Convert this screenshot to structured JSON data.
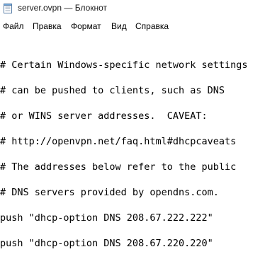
{
  "window": {
    "title": "server.ovpn — Блокнот"
  },
  "menu": {
    "items": [
      "Файл",
      "Правка",
      "Формат",
      "Вид",
      "Справка"
    ]
  },
  "editor": {
    "lines": [
      "# Certain Windows-specific network settings",
      "# can be pushed to clients, such as DNS",
      "# or WINS server addresses.  CAVEAT:",
      "# http://openvpn.net/faq.html#dhcpcaveats",
      "# The addresses below refer to the public",
      "# DNS servers provided by opendns.com.",
      "push \"dhcp-option DNS 208.67.222.222\"",
      "push \"dhcp-option DNS 208.67.220.220\""
    ]
  }
}
